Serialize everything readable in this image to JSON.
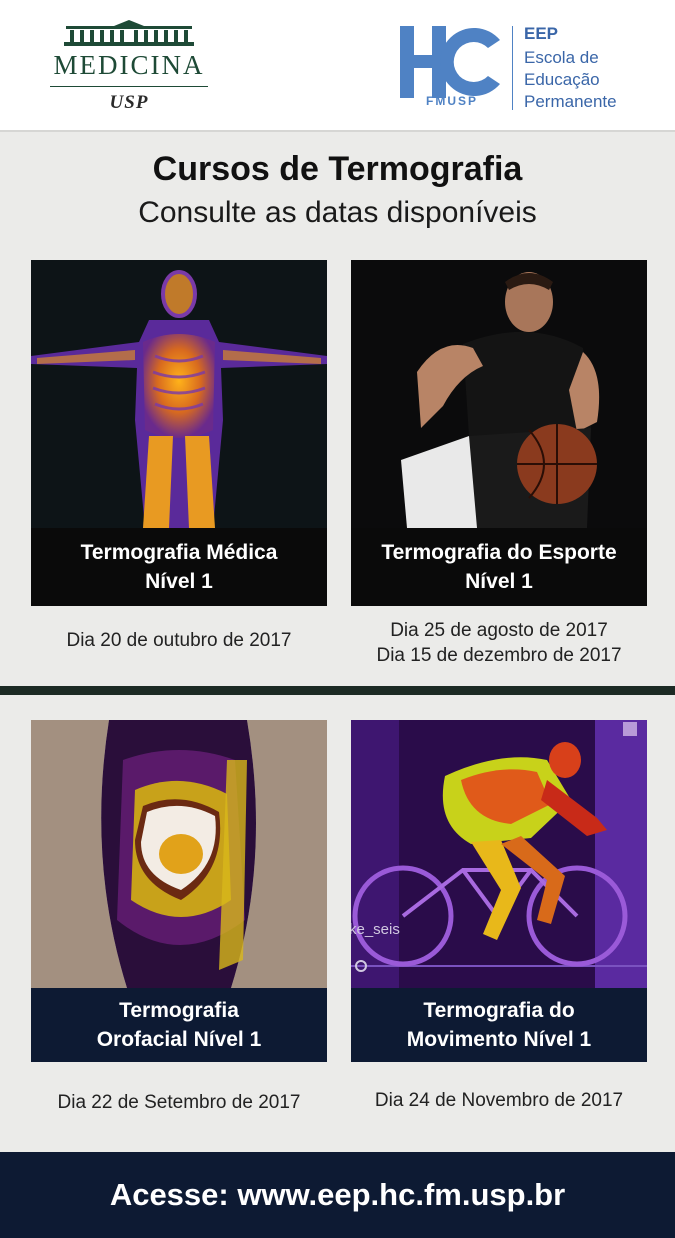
{
  "header": {
    "medicina_word": "MEDICINA",
    "medicina_sub": "USP",
    "hc_mark": "HC",
    "hc_sub": "FMUSP",
    "eep_title": "EEP",
    "eep_lines": [
      "Escola de",
      "Educação",
      "Permanente"
    ]
  },
  "headline": {
    "title": "Cursos de Termografia",
    "subtitle": "Consulte as datas disponíveis"
  },
  "courses": [
    {
      "line1": "Termografia Médica",
      "line2": "Nível 1",
      "dates": [
        "Dia 20 de outubro de 2017"
      ]
    },
    {
      "line1": "Termografia do Esporte",
      "line2": "Nível 1",
      "dates": [
        "Dia 25 de agosto de 2017",
        "Dia 15 de dezembro de 2017"
      ]
    },
    {
      "line1": "Termografia",
      "line2": "Orofacial Nível 1",
      "dates": [
        "Dia 22 de Setembro de 2017"
      ]
    },
    {
      "line1": "Termografia do",
      "line2": "Movimento Nível 1",
      "dates": [
        "Dia 24 de Novembro de 2017"
      ]
    }
  ],
  "image_text": {
    "cyclist_caption": "ke_seis"
  },
  "footer": {
    "text": "Acesse: www.eep.hc.fm.usp.br"
  },
  "colors": {
    "navy": "#0d1a33",
    "hc_blue": "#4f82c4",
    "medicina_green": "#1e4a36"
  }
}
